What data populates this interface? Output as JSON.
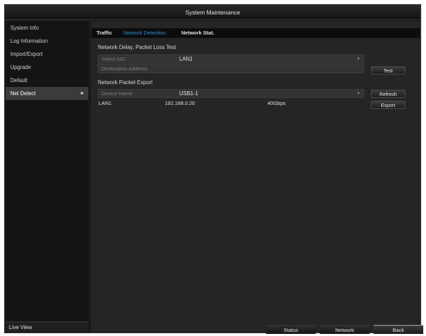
{
  "window": {
    "title": "System Maintenance"
  },
  "sidebar": {
    "items": [
      {
        "label": "System Info"
      },
      {
        "label": "Log Information"
      },
      {
        "label": "Import/Export"
      },
      {
        "label": "Upgrade"
      },
      {
        "label": "Default"
      },
      {
        "label": "Net Detect",
        "active": true,
        "arrow": "►"
      }
    ],
    "live_view": "Live View"
  },
  "tabs": [
    {
      "label": "Traffic"
    },
    {
      "label": "Network Detection",
      "active": true
    },
    {
      "label": "Network Stat."
    }
  ],
  "delay_section": {
    "title": "Network Delay, Packet Loss Test",
    "select_nic": {
      "label": "Select NIC",
      "value": "LAN1"
    },
    "destination": {
      "label": "Destination Address",
      "value": ""
    },
    "test_button": "Test"
  },
  "export_section": {
    "title": "Network Packet Export",
    "device": {
      "label": "Device Name",
      "value": "USB1-1"
    },
    "refresh_button": "Refresh",
    "export_button": "Export",
    "rows": [
      {
        "interface": "LAN1",
        "address": "192.168.0.20",
        "speed": "40Gbps"
      }
    ]
  },
  "bottom_buttons": {
    "status": "Status",
    "network": "Network",
    "back": "Back"
  },
  "colors": {
    "accent": "#2e8fd6",
    "background": "#252525",
    "sidebar": "#141414"
  }
}
